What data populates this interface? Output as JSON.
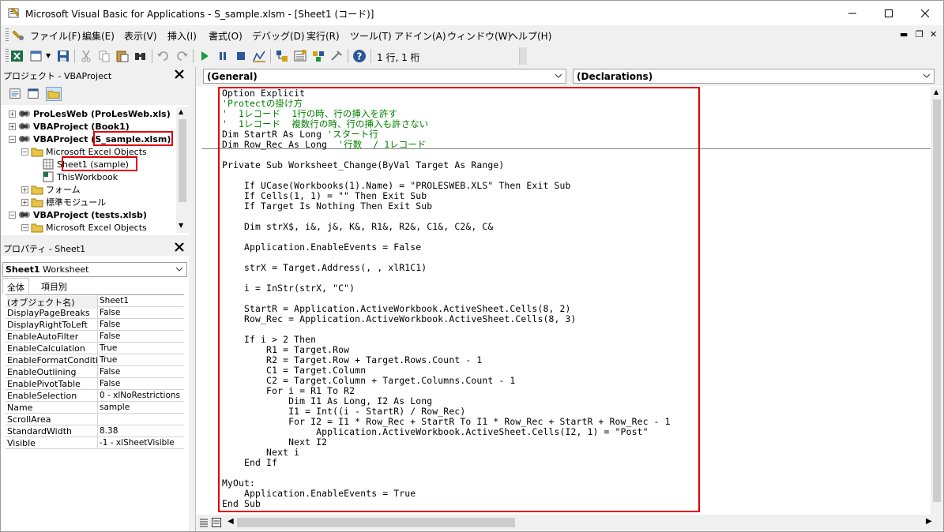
{
  "window": {
    "title": "Microsoft Visual Basic for Applications - S_sample.xlsm - [Sheet1 (コード)]"
  },
  "menu": [
    "ファイル(F)",
    "編集(E)",
    "表示(V)",
    "挿入(I)",
    "書式(O)",
    "デバッグ(D)",
    "実行(R)",
    "ツール(T)",
    "アドイン(A)",
    "ウィンドウ(W)",
    "ヘルプ(H)"
  ],
  "toolbar": {
    "position": "1 行, 1 桁"
  },
  "project": {
    "title": "プロジェクト - VBAProject",
    "tree": [
      {
        "label": "ProLesWeb (ProLesWeb.xls)",
        "bold": true
      },
      {
        "label": "VBAProject (Book1)",
        "bold": true
      },
      {
        "label": "VBAProject (S_sample.xlsm)",
        "bold": true
      },
      {
        "label": "Microsoft Excel Objects",
        "bold": false
      },
      {
        "label": "Sheet1 (sample)",
        "bold": false
      },
      {
        "label": "ThisWorkbook",
        "bold": false
      },
      {
        "label": "フォーム",
        "bold": false
      },
      {
        "label": "標準モジュール",
        "bold": false
      },
      {
        "label": "VBAProject (tests.xlsb)",
        "bold": true
      },
      {
        "label": "Microsoft Excel Objects",
        "bold": false
      }
    ]
  },
  "properties": {
    "title": "プロパティ - Sheet1",
    "object_name": "Sheet1",
    "object_type": "Worksheet",
    "tabs": [
      "全体",
      "項目別"
    ],
    "rows": [
      [
        "(オブジェクト名)",
        "Sheet1"
      ],
      [
        "DisplayPageBreaks",
        "False"
      ],
      [
        "DisplayRightToLeft",
        "False"
      ],
      [
        "EnableAutoFilter",
        "False"
      ],
      [
        "EnableCalculation",
        "True"
      ],
      [
        "EnableFormatConditions",
        "True"
      ],
      [
        "EnableOutlining",
        "False"
      ],
      [
        "EnablePivotTable",
        "False"
      ],
      [
        "EnableSelection",
        "0 - xlNoRestrictions"
      ],
      [
        "Name",
        "sample"
      ],
      [
        "ScrollArea",
        ""
      ],
      [
        "StandardWidth",
        "8.38"
      ],
      [
        "Visible",
        "-1 - xlSheetVisible"
      ]
    ]
  },
  "code": {
    "object_dropdown": "(General)",
    "proc_dropdown": "(Declarations)",
    "lines": [
      "Option Explicit",
      "'Protectの掛け方",
      "'  1レコード  1行の時、行の挿入を許す",
      "'  1レコード  複数行の時、行の挿入も許さない",
      "Dim StartR As Long 'スタート行",
      "Dim Row_Rec As Long  '行数  / 1レコード",
      "",
      "Private Sub Worksheet_Change(ByVal Target As Range)",
      "",
      "    If UCase(Workbooks(1).Name) = \"PROLESWEB.XLS\" Then Exit Sub",
      "    If Cells(1, 1) = \"\" Then Exit Sub",
      "    If Target Is Nothing Then Exit Sub",
      "",
      "    Dim strX$, i&, j&, K&, R1&, R2&, C1&, C2&, C&",
      "",
      "    Application.EnableEvents = False",
      "",
      "    strX = Target.Address(, , xlR1C1)",
      "",
      "    i = InStr(strX, \"C\")",
      "",
      "    StartR = Application.ActiveWorkbook.ActiveSheet.Cells(8, 2)",
      "    Row_Rec = Application.ActiveWorkbook.ActiveSheet.Cells(8, 3)",
      "",
      "    If i > 2 Then",
      "        R1 = Target.Row",
      "        R2 = Target.Row + Target.Rows.Count - 1",
      "        C1 = Target.Column",
      "        C2 = Target.Column + Target.Columns.Count - 1",
      "        For i = R1 To R2",
      "            Dim I1 As Long, I2 As Long",
      "            I1 = Int((i - StartR) / Row_Rec)",
      "            For I2 = I1 * Row_Rec + StartR To I1 * Row_Rec + StartR + Row_Rec - 1",
      "                 Application.ActiveWorkbook.ActiveSheet.Cells(I2, 1) = \"Post\"",
      "            Next I2",
      "        Next i",
      "    End If",
      "",
      "MyOut:",
      "    Application.EnableEvents = True",
      "End Sub"
    ]
  }
}
